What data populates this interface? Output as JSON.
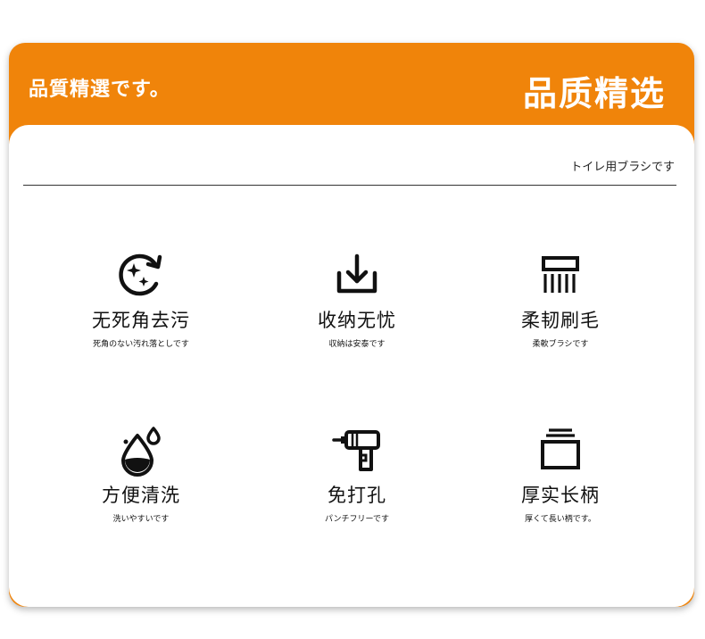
{
  "header": {
    "left_text": "品質精選です。",
    "right_text": "品质精选"
  },
  "panel": {
    "subtitle": "トイレ用ブラシです"
  },
  "features": [
    {
      "icon": "refresh-sparkle-icon",
      "title": "无死角去污",
      "sub": "死角のない汚れ落としです"
    },
    {
      "icon": "download-tray-icon",
      "title": "收纳无忧",
      "sub": "収納は安泰です"
    },
    {
      "icon": "brush-bristles-icon",
      "title": "柔韧刷毛",
      "sub": "柔軟ブラシです"
    },
    {
      "icon": "water-drop-icon",
      "title": "方便清洗",
      "sub": "洗いやすいです"
    },
    {
      "icon": "drill-icon",
      "title": "免打孔",
      "sub": "パンチフリーです"
    },
    {
      "icon": "stacked-box-icon",
      "title": "厚实长柄",
      "sub": "厚くて長い柄です。"
    }
  ],
  "colors": {
    "accent": "#f0840a",
    "text": "#111111"
  }
}
